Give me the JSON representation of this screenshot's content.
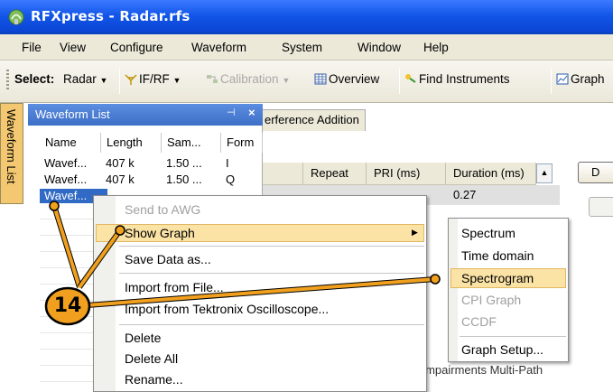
{
  "window": {
    "title": "RFXpress - Radar.rfs",
    "icon": "app-icon"
  },
  "menu": [
    "File",
    "View",
    "Configure",
    "Waveform",
    "System",
    "Window",
    "Help"
  ],
  "toolbar": {
    "select_label": "Select:",
    "radar": "Radar",
    "ifrf": "IF/RF",
    "calibration": "Calibration",
    "overview": "Overview",
    "find_instruments": "Find Instruments",
    "graph": "Graph"
  },
  "side_tab": "Waveform List",
  "waveform_list": {
    "title": "Waveform List",
    "columns": [
      "Name",
      "Length",
      "Sam...",
      "Form"
    ],
    "rows": [
      [
        "Wavef...",
        "407 k",
        "1.50 ...",
        "I"
      ],
      [
        "Wavef...",
        "407 k",
        "1.50 ...",
        "Q"
      ],
      [
        "Wavef..."
      ]
    ]
  },
  "main": {
    "tab_label": "erference Addition",
    "columns": [
      "Repeat",
      "PRI (ms)",
      "Duration (ms)"
    ],
    "row": {
      "duration": "0.27"
    },
    "button_d": "D",
    "bottom_tabs": "ulse Impairments  Multi-Path"
  },
  "context_menu": {
    "items": [
      {
        "label": "Send to AWG",
        "enabled": false
      },
      {
        "label": "Show Graph",
        "enabled": true,
        "submenu": true
      },
      {
        "label": "Save Data as...",
        "enabled": true
      },
      {
        "label": "Import from File...",
        "enabled": true
      },
      {
        "label": "Import from Tektronix Oscilloscope...",
        "enabled": true
      },
      {
        "label": "Delete",
        "enabled": true
      },
      {
        "label": "Delete All",
        "enabled": true
      },
      {
        "label": "Rename...",
        "enabled": true
      }
    ]
  },
  "submenu": {
    "items": [
      {
        "label": "Spectrum",
        "enabled": true
      },
      {
        "label": "Time domain",
        "enabled": true
      },
      {
        "label": "Spectrogram",
        "enabled": true
      },
      {
        "label": "CPI Graph",
        "enabled": false
      },
      {
        "label": "CCDF",
        "enabled": false
      },
      {
        "label": "Graph Setup...",
        "enabled": true
      }
    ]
  },
  "callout": {
    "number": "14",
    "color": "#f0a01e"
  }
}
